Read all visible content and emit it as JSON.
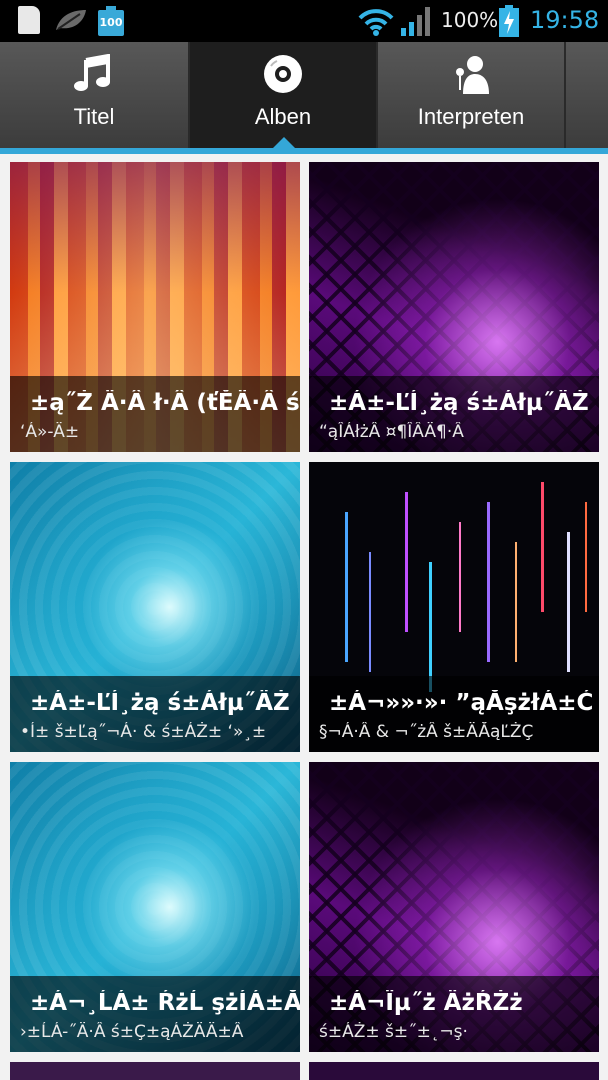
{
  "status_bar": {
    "battery_small_label": "100",
    "battery_percent": "100%",
    "time": "19:58",
    "icons": [
      "sd-card-icon",
      "leaf-icon",
      "battery-icon",
      "wifi-icon",
      "signal-icon",
      "charging-battery-icon"
    ],
    "accent": "#35b4e6"
  },
  "tabs": [
    {
      "label": "Titel",
      "icon": "music-note-icon",
      "active": false
    },
    {
      "label": "Alben",
      "icon": "disc-icon",
      "active": true
    },
    {
      "label": "Interpreten",
      "icon": "singer-icon",
      "active": false
    }
  ],
  "albums": [
    {
      "title": "±ą˝Ż Ä·Â ł·Â (ťĚÄ·Â ś",
      "subtitle": "‘Á»-Ä±"
    },
    {
      "title": "±Á±-ĽÍ¸żą ś±Áłµ˝ÄŻ",
      "subtitle": "“ąÎÁłżÂ ¤¶ÎÂÄ¶·Â"
    },
    {
      "title": "±Á±-ĽÍ¸żą ś±Áłµ˝ÄŻ",
      "subtitle": "•Í± š±Ľą˝¬Á· & ś±ÁŻ± ‘»¸±"
    },
    {
      "title": "±Á¬»»·»· ”ąĂşżłÁ±Ć",
      "subtitle": "§¬Á·Â & ¬˝żÂ š±ÄĂąĽŻÇ"
    },
    {
      "title": "±Á¬¸ĹÁ± ŔżĹ şżÍÁ±Ă",
      "subtitle": "›±ĹÁ-˝Ä·Â ś±Ç±ąÁŻÄÄ±Â"
    },
    {
      "title": "±Á¬Ïµ˝ż ÄżŔŻż",
      "subtitle": "ś±ÁŻ± š±˝±˛¬ş·"
    }
  ],
  "colors": {
    "tab_indicator": "#34a7d8",
    "status_bg": "#000000"
  }
}
